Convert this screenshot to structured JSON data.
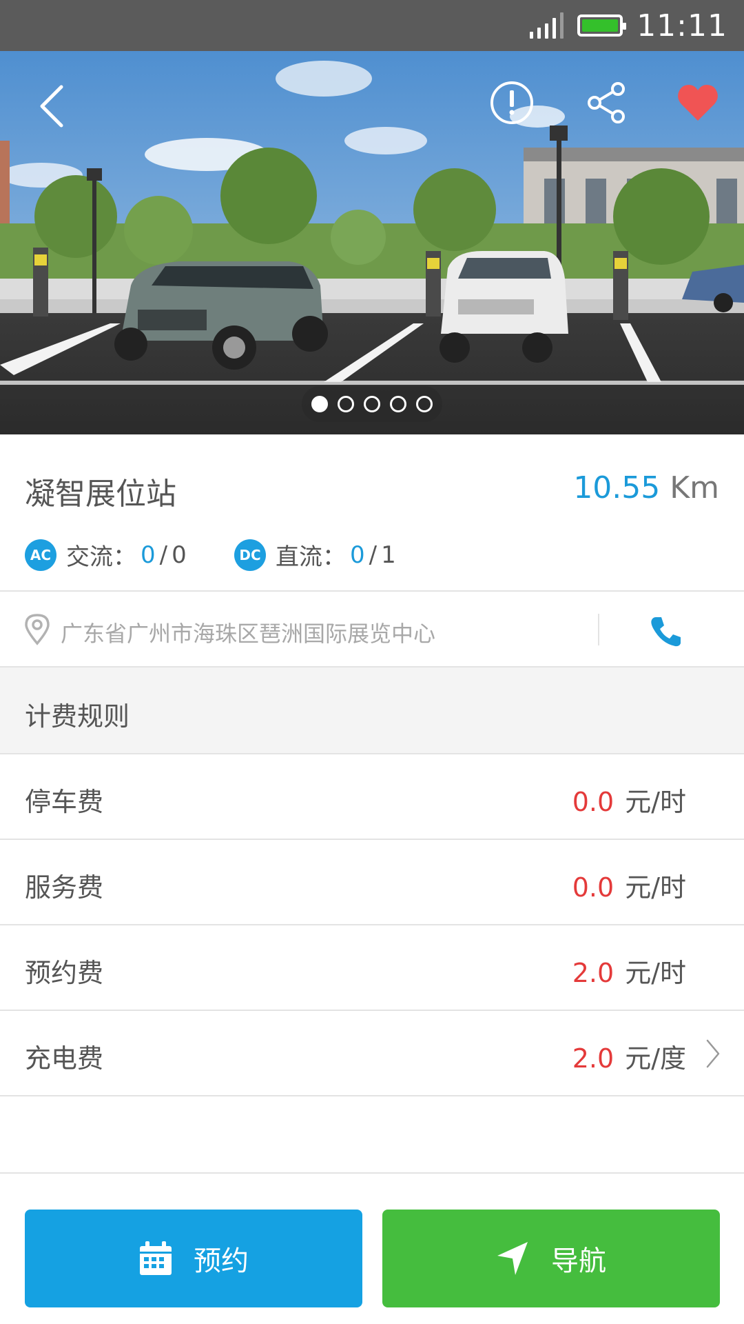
{
  "status_bar": {
    "time": "11:11"
  },
  "hero": {
    "icons": {
      "back": "chevron-left-icon",
      "report": "exclamation-circle-icon",
      "share": "share-icon",
      "favorite": "heart-icon"
    },
    "favorite_color": "#f05454",
    "carousel": {
      "count": 5,
      "active_index": 0
    }
  },
  "station": {
    "name": "凝智展位站",
    "distance_value": "10.55",
    "distance_unit": "Km",
    "ac": {
      "badge": "AC",
      "label": "交流：",
      "available": "0",
      "separator": "/",
      "total": "0"
    },
    "dc": {
      "badge": "DC",
      "label": "直流：",
      "available": "0",
      "separator": "/",
      "total": "1"
    }
  },
  "address": {
    "text": "广东省广州市海珠区琶洲国际展览中心"
  },
  "fees": {
    "header": "计费规则",
    "rows": [
      {
        "label": "停车费",
        "price": "0.0",
        "unit": "元/时"
      },
      {
        "label": "服务费",
        "price": "0.0",
        "unit": "元/时"
      },
      {
        "label": "预约费",
        "price": "2.0",
        "unit": "元/时"
      },
      {
        "label": "充电费",
        "price": "2.0",
        "unit": "元/度"
      }
    ]
  },
  "actions": {
    "reserve_label": "预约",
    "navigate_label": "导航"
  },
  "colors": {
    "accent_blue": "#15a1e2",
    "accent_green": "#45bd3e",
    "price_red": "#e43a3a"
  }
}
